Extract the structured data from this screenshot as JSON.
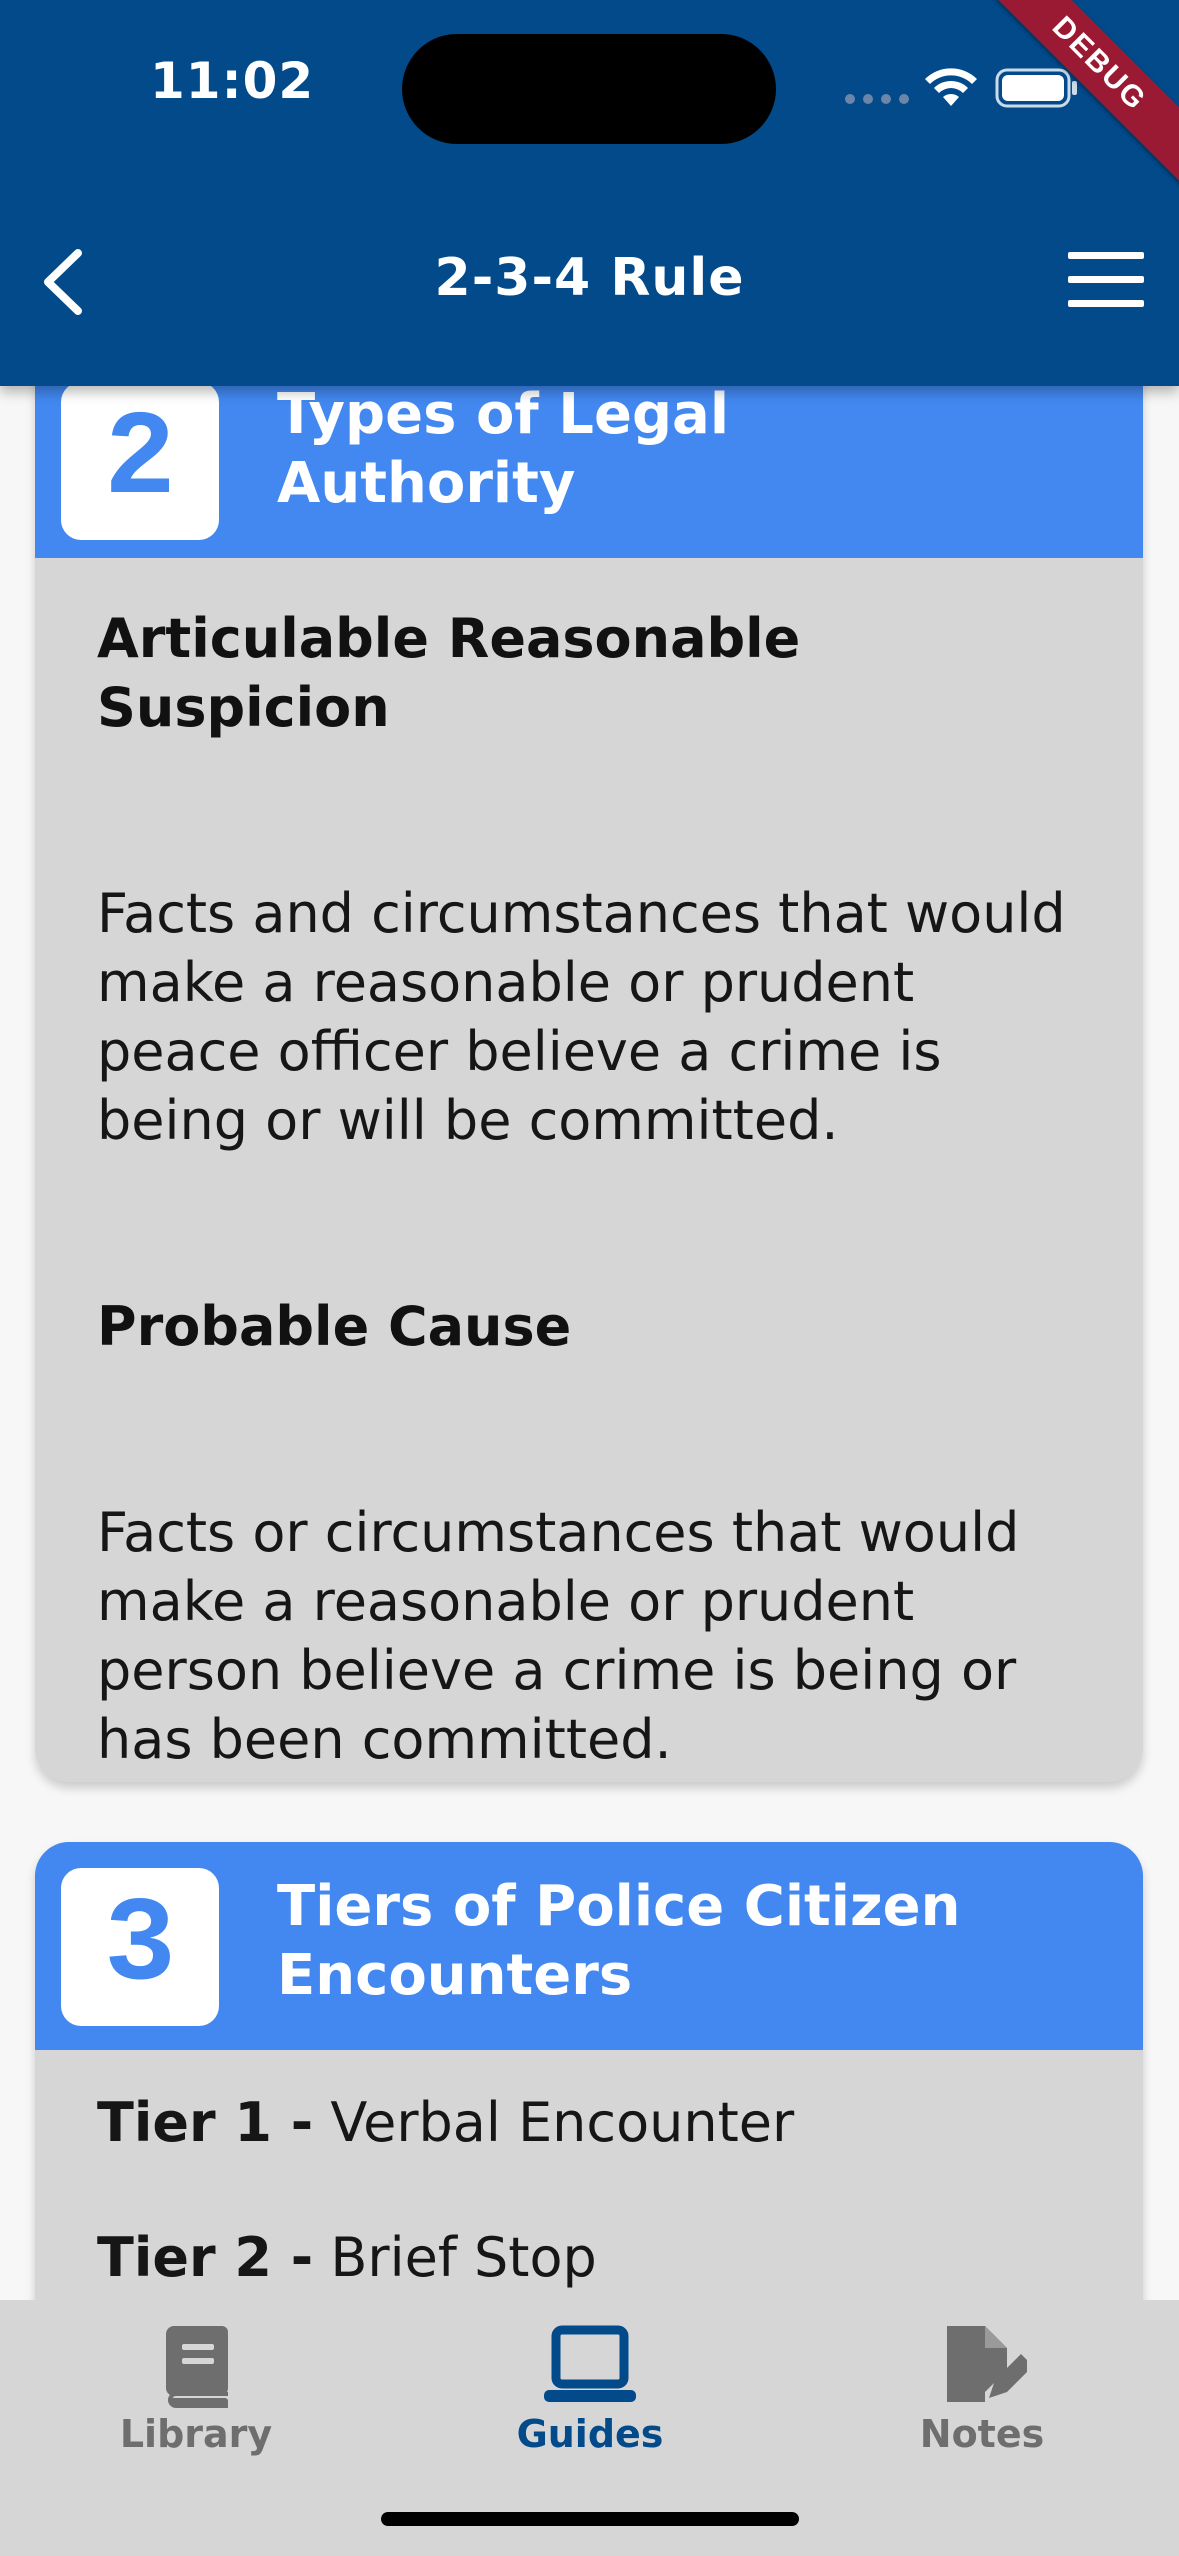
{
  "status_bar": {
    "time": "11:02",
    "debug_label": "DEBUG"
  },
  "header": {
    "title": "2-3-4 Rule"
  },
  "cards": [
    {
      "number": "2",
      "title_line1": "Types of Legal",
      "title_line2": "Authority",
      "sections": [
        {
          "heading": "Articulable Reasonable Suspicion",
          "text": "Facts and circumstances that would make a reasonable or prudent peace officer believe a crime is being or will be committed."
        },
        {
          "heading": "Probable Cause",
          "text": "Facts or circumstances that would make a reasonable or prudent person believe a crime is being or has been committed."
        }
      ]
    },
    {
      "number": "3",
      "title_line1": "Tiers of Police Citizen",
      "title_line2": "Encounters",
      "tiers": [
        {
          "label": "Tier 1 -",
          "text": "Verbal Encounter"
        },
        {
          "label": "Tier 2 -",
          "text": "Brief Stop"
        }
      ]
    }
  ],
  "bottom_nav": {
    "items": [
      {
        "label": "Library",
        "icon": "book-icon",
        "active": false
      },
      {
        "label": "Guides",
        "icon": "laptop-icon",
        "active": true
      },
      {
        "label": "Notes",
        "icon": "note-edit-icon",
        "active": false
      }
    ],
    "colors": {
      "active": "#024a8a",
      "inactive": "#6e6e6e"
    }
  },
  "colors": {
    "appbar": "#024a8a",
    "card_header": "#4288f0",
    "card_body": "#d6d6d6",
    "debug_ribbon": "#9b1a33"
  }
}
